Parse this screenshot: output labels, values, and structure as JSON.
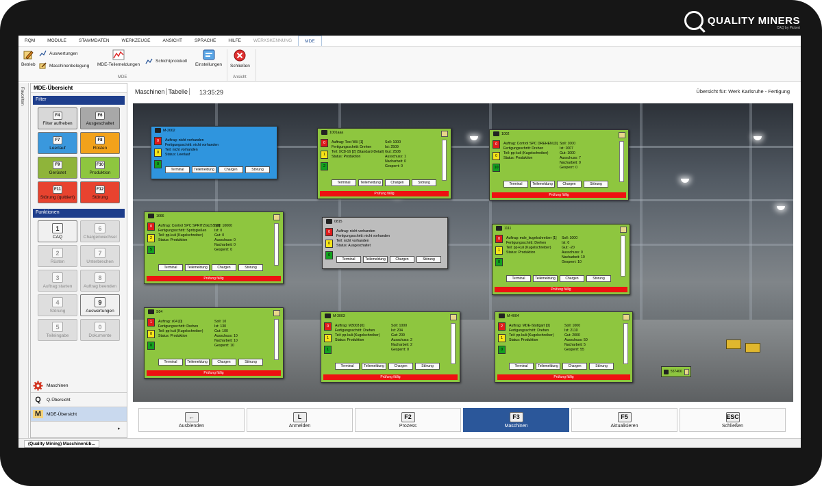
{
  "brand": {
    "name": "QUALITY MINERS",
    "sub": "CAQ by Pickert"
  },
  "menu": [
    "RQM",
    "MODULE",
    "STAMMDATEN",
    "WERKZEUGE",
    "ANSICHT",
    "SPRACHE",
    "HILFE",
    "WERKSKENNUNG",
    "MDE"
  ],
  "ribbon": {
    "betrieb": "Betrieb",
    "auswertungen": "Auswertungen",
    "maschinenbelegung": "Maschinenbelegung",
    "mde_teilemeldungen": "MDE-Teilemeldungen",
    "schichtprotokoll": "Schichtprotokoll",
    "einstellungen": "Einstellungen",
    "schliessen": "Schließen",
    "group_mde": "MDE",
    "group_ansicht": "Ansicht"
  },
  "favoriten": "Favoriten",
  "sidebar": {
    "title": "MDE-Übersicht",
    "filter_label": "Filter",
    "functions_label": "Funktionen",
    "filters": [
      {
        "key": "F4",
        "label": "Filter aufheben",
        "color": "#d8d8d8"
      },
      {
        "key": "F6",
        "label": "Ausgeschaltet",
        "color": "#a8a8a8"
      },
      {
        "key": "F7",
        "label": "Leerlauf",
        "color": "#3a98dd"
      },
      {
        "key": "F8",
        "label": "Rüsten",
        "color": "#f2a21b"
      },
      {
        "key": "F9",
        "label": "Gerüstet",
        "color": "#8fb43a"
      },
      {
        "key": "F10",
        "label": "Produktion",
        "color": "#8ec63f"
      },
      {
        "key": "F11",
        "label": "Störung (quittiert)",
        "color": "#e8432f"
      },
      {
        "key": "F12",
        "label": "Störung",
        "color": "#e8432f"
      }
    ],
    "functions": [
      {
        "key": "1",
        "label": "CAQ",
        "enabled": true
      },
      {
        "key": "6",
        "label": "Chargenwechsel",
        "enabled": false
      },
      {
        "key": "2",
        "label": "Rüsten",
        "enabled": false
      },
      {
        "key": "7",
        "label": "Unterbrechen",
        "enabled": false
      },
      {
        "key": "3",
        "label": "Auftrag starten",
        "enabled": false
      },
      {
        "key": "8",
        "label": "Auftrag beenden",
        "enabled": false
      },
      {
        "key": "4",
        "label": "Störung",
        "enabled": false
      },
      {
        "key": "9",
        "label": "Auswertungen",
        "enabled": true
      },
      {
        "key": "5",
        "label": "Teileingabe",
        "enabled": false
      },
      {
        "key": "0",
        "label": "Dokumente",
        "enabled": false
      }
    ],
    "nav": [
      {
        "label": "Maschinen",
        "icon": "gear-icon"
      },
      {
        "label": "Q-Übersicht",
        "icon": "q-icon"
      },
      {
        "label": "MDE-Übersicht",
        "icon": "m-icon"
      }
    ]
  },
  "main": {
    "tab_maschinen": "Maschinen",
    "tab_tabelle": "Tabelle",
    "time": "13:35:29",
    "overview": "Übersicht für: Werk Karlsruhe - Fertigung"
  },
  "card_buttons": {
    "terminal": "Terminal",
    "teilemeldung": "Teilemeldung",
    "chargen": "Chargen",
    "stoerung": "Störung",
    "pruefung": "Prüfung fällig"
  },
  "machines": [
    {
      "id": "M-2002",
      "color": "blue",
      "nums": [
        "0",
        "0",
        "0"
      ],
      "left": [
        "Auftrag: nicht vorhanden",
        "Fertigungsschritt: nicht vorhanden",
        "Teil: nicht vorhanden",
        "Status: Leerlauf"
      ],
      "right": [],
      "pruefung": false
    },
    {
      "id": "1001aaa",
      "color": "green",
      "nums": [
        "0",
        "1",
        "2"
      ],
      "left": [
        "Auftrag: Test WH [1]",
        "Fertigungsschritt: Drehen",
        "Teil: XC8-16 [2] (Standard-Detail)",
        "Status: Produktion"
      ],
      "right": [
        "Soll: 1000",
        "Ist: 2509",
        "Gut: 2508",
        "Ausschuss: 1",
        "Nacharbeit: 0",
        "Gesperrt: 0"
      ],
      "pruefung": true
    },
    {
      "id": "1002",
      "color": "green",
      "nums": [
        "0",
        "0",
        "10"
      ],
      "left": [
        "Auftrag: Control SPC DREHEN [0]",
        "Fertigungsschritt: Drehen",
        "Teil: pp-kuli (Kugelschreiber)",
        "Status: Produktion"
      ],
      "right": [
        "Soll: 1000",
        "Ist: 1007",
        "Gut: 1000",
        "Ausschuss: 7",
        "Nacharbeit: 0",
        "Gesperrt: 0"
      ],
      "pruefung": true
    },
    {
      "id": "1666",
      "color": "green",
      "nums": [
        "0",
        "2",
        "5"
      ],
      "left": [
        "Auftrag: Control SPC SPRITZGUSS [0]",
        "Fertigungsschritt: Spritzgießen",
        "Teil: pp-kuli (Kugelschreiber)",
        "Status: Produktion"
      ],
      "right": [
        "Soll: 10000",
        "Ist: 0",
        "Gut: 0",
        "Ausschuss: 0",
        "Nacharbeit: 0",
        "Gesperrt: 0"
      ],
      "pruefung": true
    },
    {
      "id": "0815",
      "color": "gray",
      "nums": [
        "0",
        "0",
        "0"
      ],
      "left": [
        "Auftrag: nicht vorhanden",
        "Fertigungsschritt: nicht vorhanden",
        "Teil: nicht vorhanden",
        "Status: Ausgeschaltet"
      ],
      "right": [],
      "pruefung": false
    },
    {
      "id": "1111",
      "color": "green",
      "nums": [
        "0",
        "1",
        "0"
      ],
      "left": [
        "Auftrag: mde_kugelschreiber [1]",
        "Fertigungsschritt: Drehen",
        "Teil: pp-kuli (Kugelschreiber)",
        "Status: Produktion"
      ],
      "right": [
        "Soll: 1000",
        "Ist: 0",
        "Gut: -20",
        "Ausschuss: 0",
        "Nacharbeit: 10",
        "Gesperrt: 10"
      ],
      "pruefung": true
    },
    {
      "id": "S04",
      "color": "green",
      "nums": [
        "1",
        "0",
        "0"
      ],
      "left": [
        "Auftrag: s04 [0]",
        "Fertigungsschritt: Drehen",
        "Teil: pp-kuli (Kugelschreiber)",
        "Status: Produktion"
      ],
      "right": [
        "Soll: 10",
        "Ist: 130",
        "Gut: 100",
        "Ausschuss: 10",
        "Nacharbeit: 10",
        "Gesperrt: 10"
      ],
      "pruefung": true
    },
    {
      "id": "M-3003",
      "color": "green",
      "nums": [
        "0",
        "1",
        "1"
      ],
      "left": [
        "Auftrag: M3003 [0]",
        "Fertigungsschritt: Drehen",
        "Teil: pp-kuli (Kugelschreiber)",
        "Status: Produktion"
      ],
      "right": [
        "Soll: 1000",
        "Ist: 204",
        "Gut: 200",
        "Ausschuss: 2",
        "Nacharbeit: 2",
        "Gesperrt: 0"
      ],
      "pruefung": true
    },
    {
      "id": "M-4004",
      "color": "green",
      "nums": [
        "2",
        "1",
        "0"
      ],
      "left": [
        "Auftrag: MDE-Stuttgart [0]",
        "Fertigungsschritt: Drehen",
        "Teil: pp-kuli (Kugelschreiber)",
        "Status: Produktion"
      ],
      "right": [
        "Soll: 1000",
        "Ist: 2110",
        "Gut: 2000",
        "Ausschuss: 50",
        "Nacharbeit: 5",
        "Gesperrt: 55"
      ],
      "pruefung": true
    }
  ],
  "mini_machine": "557406",
  "bottom_keys": [
    {
      "key": "←",
      "label": "Ausblenden",
      "selected": false
    },
    {
      "key": "L",
      "label": "Anmelden",
      "selected": false
    },
    {
      "key": "F2",
      "label": "Prozess",
      "selected": false
    },
    {
      "key": "F3",
      "label": "Maschinen",
      "selected": true
    },
    {
      "key": "F5",
      "label": "Aktualisieren",
      "selected": false
    },
    {
      "key": "ESC",
      "label": "Schließen",
      "selected": false
    }
  ],
  "statusbar": {
    "task": "(Quality Mining) Maschinenüb..."
  }
}
